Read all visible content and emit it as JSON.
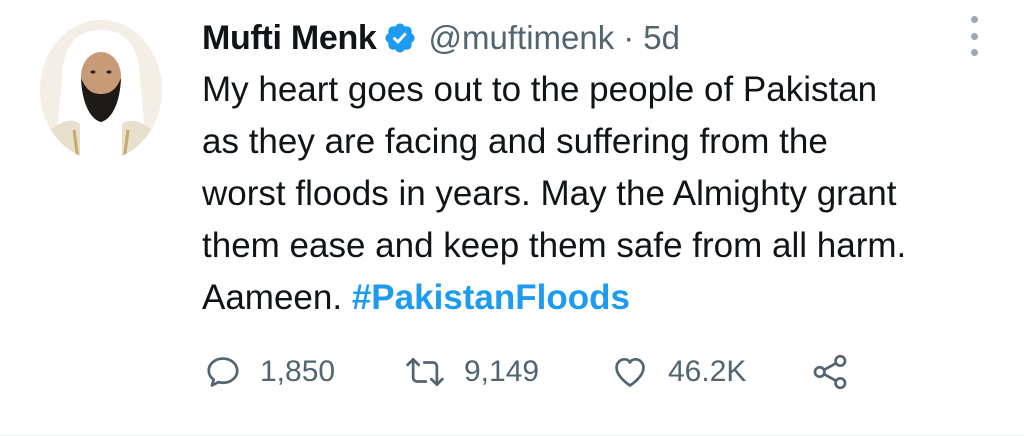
{
  "tweet": {
    "author": {
      "name": "Mufti Menk",
      "handle": "@muftimenk",
      "verified": true
    },
    "separator": "·",
    "time": "5d",
    "text_lines": [
      "My heart goes out to the people of Pakistan",
      "as they are facing and suffering from the",
      "worst floods in years. May the Almighty grant",
      "them ease and keep them safe from all harm."
    ],
    "last_line_text": "Aameen.",
    "hashtag": "#PakistanFloods",
    "actions": {
      "replies": "1,850",
      "retweets": "9,149",
      "likes": "46.2K"
    }
  },
  "colors": {
    "text": "#0f1419",
    "secondary": "#536471",
    "link": "#1d9bf0",
    "verified_badge": "#1d9bf0"
  },
  "icons": {
    "avatar": "avatar",
    "verified": "verified-badge-icon",
    "more": "more-options-icon",
    "reply": "reply-icon",
    "retweet": "retweet-icon",
    "like": "heart-icon",
    "share": "share-icon"
  }
}
